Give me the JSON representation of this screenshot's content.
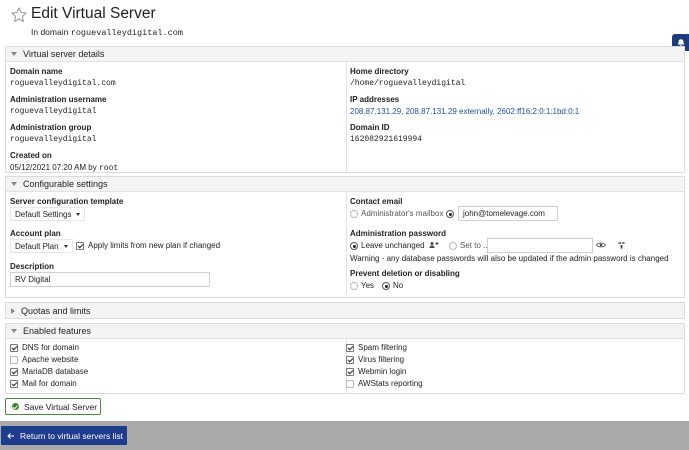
{
  "header": {
    "title": "Edit Virtual Server",
    "subtitle_prefix": "In domain",
    "subtitle_domain": "roguevalleydigital.com"
  },
  "details": {
    "heading": "Virtual server details",
    "domain_name_label": "Domain name",
    "domain_name": "roguevalleydigital.com",
    "admin_user_label": "Administration username",
    "admin_user": "roguevalleydigital",
    "admin_group_label": "Administration group",
    "admin_group": "roguevalleydigital",
    "created_label": "Created on",
    "created_date": "05/12/2021 07:20 AM by",
    "created_by": "root",
    "home_label": "Home directory",
    "home_dir": "/home/roguevalleydigital",
    "ip_label": "IP addresses",
    "ip_addresses": "208.87.131.29, 208.87.131.29 externally, 2602:ff16:2:0:1:1bd:0:1",
    "domain_id_label": "Domain ID",
    "domain_id": "162082921619994"
  },
  "config": {
    "heading": "Configurable settings",
    "template_label": "Server configuration template",
    "template_value": "Default Settings",
    "plan_label": "Account plan",
    "plan_value": "Default Plan",
    "apply_limits_label": "Apply limits from new plan if changed",
    "description_label": "Description",
    "description_value": "RV Digital",
    "contact_label": "Contact email",
    "admin_mailbox_label": "Administrator's mailbox",
    "contact_email": "john@tomelevage.com",
    "password_label": "Administration password",
    "leave_unchanged_label": "Leave unchanged",
    "set_to_label": "Set to ..",
    "password_warning": "Warning - any database passwords will also be updated if the admin password is changed",
    "prevent_label": "Prevent deletion or disabling",
    "yes_label": "Yes",
    "no_label": "No"
  },
  "quotas": {
    "heading": "Quotas and limits"
  },
  "features": {
    "heading": "Enabled features",
    "left": [
      {
        "label": "DNS for domain",
        "checked": true
      },
      {
        "label": "Apache website",
        "checked": false
      },
      {
        "label": "MariaDB database",
        "checked": true
      },
      {
        "label": "Mail for domain",
        "checked": true
      }
    ],
    "right": [
      {
        "label": "Spam filtering",
        "checked": true
      },
      {
        "label": "Virus filtering",
        "checked": true
      },
      {
        "label": "Webmin login",
        "checked": true
      },
      {
        "label": "AWStats reporting",
        "checked": false
      }
    ]
  },
  "actions": {
    "save_label": "Save Virtual Server",
    "return_label": "Return to virtual servers list"
  },
  "colors": {
    "link": "#1f4e9c",
    "primary": "#1f3c8c",
    "save_border": "#4a8a3a"
  }
}
